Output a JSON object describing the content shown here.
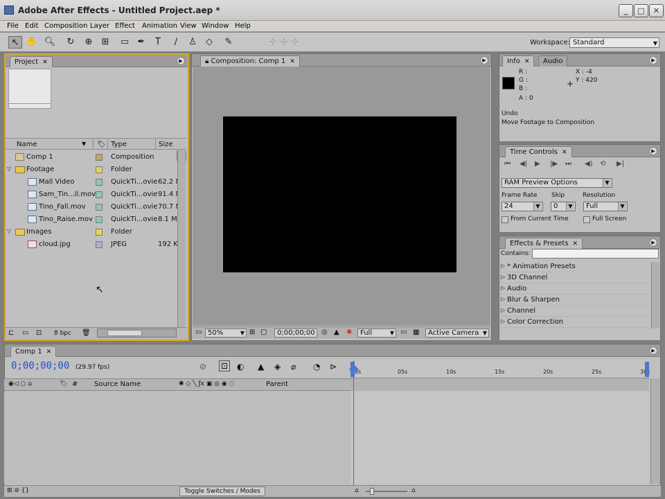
{
  "window": {
    "title": "Adobe After Effects - Untitled Project.aep *",
    "minimize": "_",
    "maximize": "□",
    "close": "✕"
  },
  "menu": [
    "File",
    "Edit",
    "Composition",
    "Layer",
    "Effect",
    "Animation",
    "View",
    "Window",
    "Help"
  ],
  "toolbar": {
    "tools": [
      "selection-tool",
      "hand-tool",
      "zoom-tool",
      "rotation-tool",
      "camera-tool",
      "pan-behind-tool",
      "mask-tool",
      "pen-tool",
      "type-tool",
      "brush-tool",
      "clone-stamp-tool",
      "eraser-tool",
      "puppet-tool"
    ],
    "workspace_label": "Workspace:",
    "workspace_value": "Standard"
  },
  "project_panel": {
    "tab": "Project",
    "columns": {
      "name": "Name",
      "type": "Type",
      "size": "Size"
    },
    "rows": [
      {
        "name": "Comp 1",
        "type": "Composition",
        "size": "",
        "kind": "comp",
        "label_color": "#b8a86e"
      },
      {
        "name": "Footage",
        "type": "Folder",
        "size": "",
        "kind": "folder",
        "label_color": "#e8d454"
      },
      {
        "name": "Mall Video",
        "type": "QuickTi...ovie",
        "size": "62.2 M",
        "kind": "file",
        "label_color": "#8fc4bc"
      },
      {
        "name": "Sam_Tin...ll.mov",
        "type": "QuickTi...ovie",
        "size": "91.4 M",
        "kind": "file",
        "label_color": "#8fc4bc"
      },
      {
        "name": "Tino_Fall.mov",
        "type": "QuickTi...ovie",
        "size": "70.7 M",
        "kind": "file",
        "label_color": "#8fc4bc"
      },
      {
        "name": "Tino_Raise.mov",
        "type": "QuickTi...ovie",
        "size": "8.1 MI",
        "kind": "file",
        "label_color": "#8fc4bc"
      },
      {
        "name": "Images",
        "type": "Folder",
        "size": "",
        "kind": "folder",
        "label_color": "#e8d454"
      },
      {
        "name": "cloud.jpg",
        "type": "JPEG",
        "size": "192 KI",
        "kind": "file",
        "label_color": "#b3a9d6"
      }
    ],
    "bpc": "8 bpc"
  },
  "composition_panel": {
    "tab": "Composition: Comp 1",
    "zoom": "50%",
    "timecode": "0;00;00;00",
    "resolution": "Full",
    "camera": "Active Camera"
  },
  "info_panel": {
    "tabs": [
      "Info",
      "Audio"
    ],
    "r": "R :",
    "g": "G :",
    "b": "B :",
    "a": "A : 0",
    "x": "X : -4",
    "y": "Y : 420",
    "undo_label": "Undo",
    "undo_action": "Move Footage to Composition"
  },
  "time_controls": {
    "tab": "Time Controls",
    "ram_preview": "RAM Preview Options",
    "frame_rate_label": "Frame Rate",
    "frame_rate": "24",
    "skip_label": "Skip",
    "skip": "0",
    "resolution_label": "Resolution",
    "resolution": "Full",
    "from_current": "From Current Time",
    "full_screen": "Full Screen"
  },
  "effects_presets": {
    "tab": "Effects & Presets",
    "contains_label": "Contains:",
    "items": [
      "* Animation Presets",
      "3D Channel",
      "Audio",
      "Blur & Sharpen",
      "Channel",
      "Color Correction"
    ]
  },
  "timeline": {
    "tab": "Comp 1",
    "timecode": "0;00;00;00",
    "fps": "(29.97 fps)",
    "source_name": "Source Name",
    "parent": "Parent",
    "ruler": [
      "0s",
      "05s",
      "10s",
      "15s",
      "20s",
      "25s",
      "30s"
    ],
    "toggle": "Toggle Switches / Modes",
    "hash": "#"
  }
}
